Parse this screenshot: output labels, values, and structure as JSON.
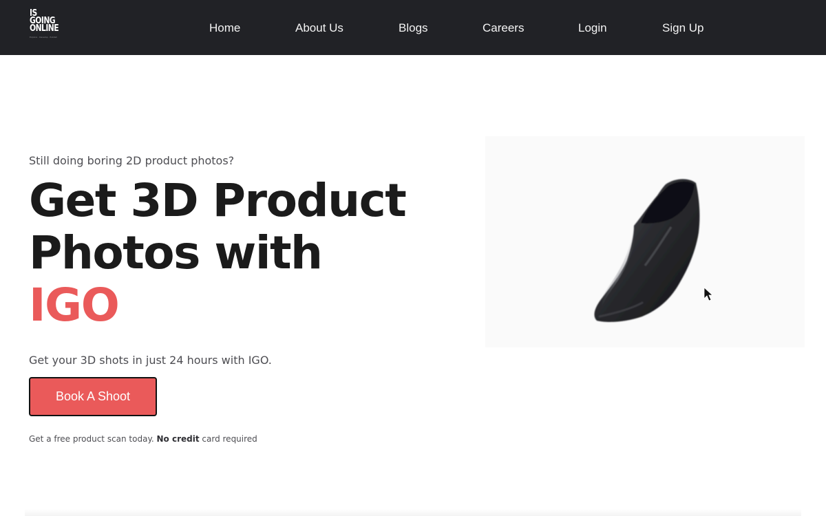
{
  "navbar": {
    "logo": {
      "line1": "IS",
      "line2": "GOING",
      "line3": "ONLINE",
      "tagline": "Explore · Develop · Publish"
    },
    "links": [
      "Home",
      "About Us",
      "Blogs",
      "Careers",
      "Login",
      "Sign Up"
    ]
  },
  "hero": {
    "eyebrow": "Still doing boring 2D product photos?",
    "headline_line1": "Get 3D Product",
    "headline_line2": "Photos with",
    "headline_accent": "IGO",
    "subtext": "Get your 3D shots in just 24 hours with IGO.",
    "cta_label": "Book A Shoot",
    "note_start": "Get a free product scan today.",
    "note_bold": "No credit",
    "note_end": "card required"
  },
  "media": {
    "subject_icon": "ankle-boot-3d-render",
    "cursor_icon": "mouse-pointer-icon"
  },
  "colors": {
    "navbar_bg": "#212226",
    "accent": "#ea5a5a",
    "text_dark": "#1b1b1b",
    "text_muted": "#4d4d52"
  }
}
